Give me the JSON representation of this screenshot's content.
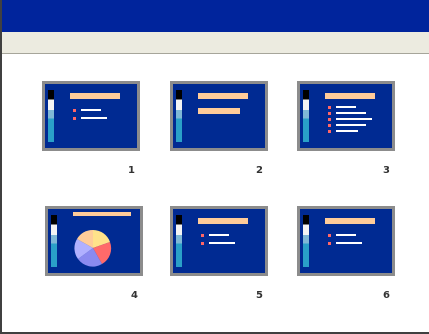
{
  "window": {
    "title": ""
  },
  "colors": {
    "titlebar": "#00249c",
    "toolbar": "#ecebe0",
    "slide_background": "#002a92",
    "slide_title": "#ffcc99",
    "slide_bullet": "#ff6666"
  },
  "slides": [
    {
      "number": "1",
      "layout": "title-and-bullets"
    },
    {
      "number": "2",
      "layout": "title-and-subtitle"
    },
    {
      "number": "3",
      "layout": "title-and-five-bullets"
    },
    {
      "number": "4",
      "layout": "title-and-pie-chart"
    },
    {
      "number": "5",
      "layout": "title-and-two-bullets"
    },
    {
      "number": "6",
      "layout": "title-and-two-bullets"
    }
  ]
}
